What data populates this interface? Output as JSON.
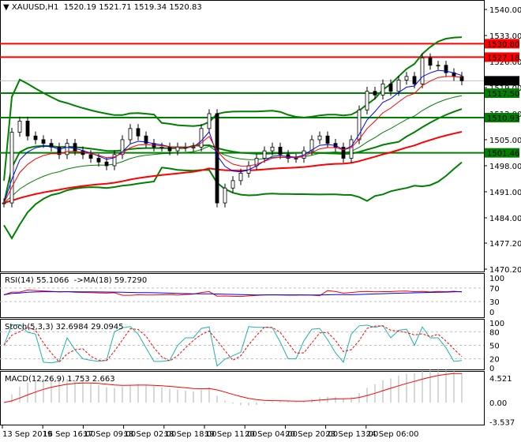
{
  "header": {
    "symbol": "XAUUSD,H1",
    "open": "1520.19",
    "high": "1521.71",
    "low": "1519.34",
    "close": "1520.83"
  },
  "price_axis": [
    "1540.00",
    "1533.00",
    "1526.00",
    "1519.00",
    "1512.00",
    "1505.00",
    "1498.00",
    "1491.00",
    "1484.00",
    "1477.20",
    "1470.20"
  ],
  "current_price": "1520.83",
  "levels": [
    {
      "value": "1530.80",
      "color": "#ff0000"
    },
    {
      "value": "1527.18",
      "color": "#ff0000"
    },
    {
      "value": "1517.50",
      "color": "#008000"
    },
    {
      "value": "1510.93",
      "color": "#008000"
    },
    {
      "value": "1501.46",
      "color": "#008000"
    }
  ],
  "rsi": {
    "label": "RSI(14) 55.1066  ->MA(18) 59.7290",
    "axis": [
      "100",
      "70",
      "30",
      "0"
    ]
  },
  "stoch": {
    "label": "Stoch(5,3,3) 32.6984 29.0945",
    "axis": [
      "100",
      "80",
      "50",
      "20",
      "0"
    ]
  },
  "macd": {
    "label": "MACD(12,26,9) 1.753 2.663",
    "axis": [
      "4.521",
      "0.00",
      "-3.537"
    ]
  },
  "time_axis": [
    "13 Sep 2019",
    "16 Sep 16:00",
    "17 Sep 09:00",
    "18 Sep 02:00",
    "18 Sep 18:00",
    "19 Sep 11:00",
    "20 Sep 04:00",
    "20 Sep 20:00",
    "23 Sep 13:00",
    "24 Sep 06:00"
  ],
  "chart_data": {
    "type": "candlestick",
    "ylim": [
      1470.2,
      1540
    ],
    "closes": [
      1488,
      1507,
      1510,
      1506,
      1505,
      1504,
      1503,
      1501,
      1504,
      1502,
      1501,
      1500,
      1499,
      1498,
      1501,
      1505,
      1508,
      1506,
      1504,
      1503,
      1503,
      1502,
      1503,
      1503,
      1503,
      1508,
      1512,
      1488,
      1492,
      1494,
      1496,
      1498,
      1500,
      1502,
      1503,
      1501,
      1500,
      1500,
      1502,
      1505,
      1506,
      1504,
      1503,
      1500,
      1505,
      1513,
      1518,
      1517,
      1520,
      1518,
      1521,
      1522,
      1520,
      1527,
      1525,
      1525,
      1523,
      1522,
      1520.83
    ]
  }
}
